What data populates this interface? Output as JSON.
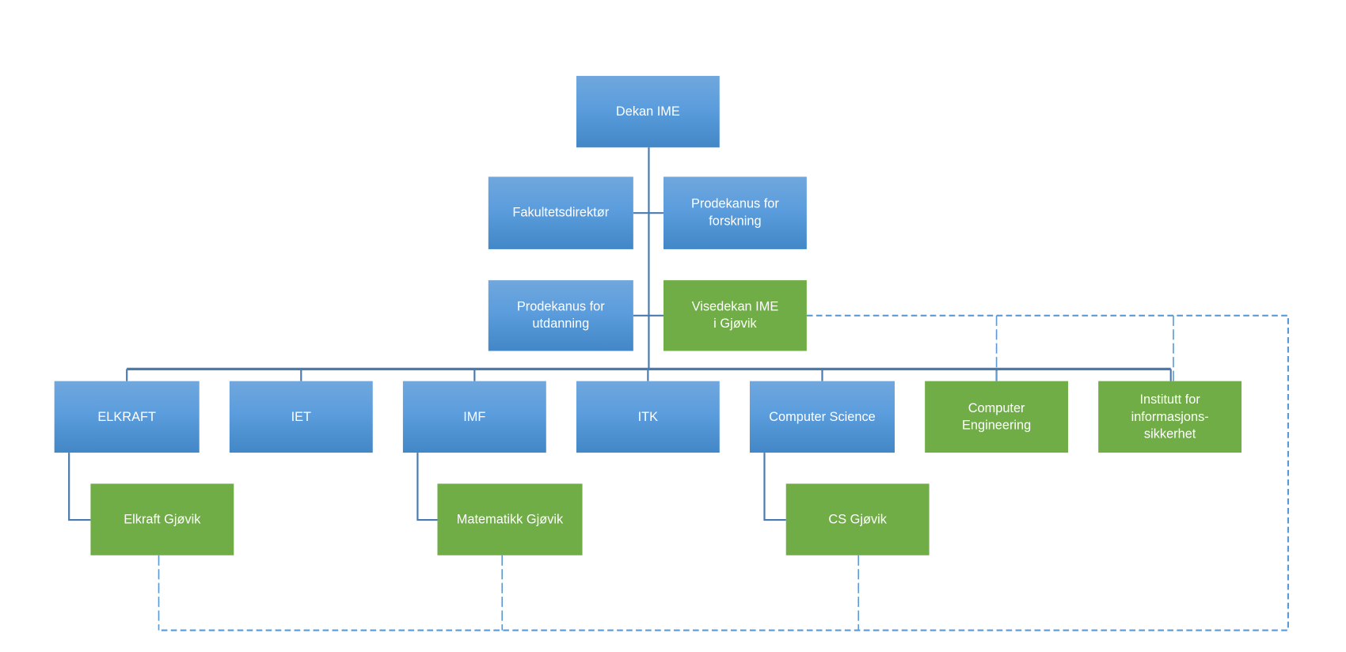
{
  "colors": {
    "blue": "#5b9bd5",
    "green": "#70ad47",
    "line": "#4a7ab0",
    "dashed": "#5b9bd5"
  },
  "top": {
    "dean": "Dekan IME"
  },
  "staff": {
    "faculty_director": "Fakultetsdirektør",
    "vice_dean_research": "Prodekanus for\nforskning",
    "vice_dean_education": "Prodekanus for\nutdanning",
    "deputy_dean_gjovik": "Visedekan IME\ni Gjøvik"
  },
  "departments": [
    {
      "label": "ELKRAFT",
      "color": "blue"
    },
    {
      "label": "IET",
      "color": "blue"
    },
    {
      "label": "IMF",
      "color": "blue"
    },
    {
      "label": "ITK",
      "color": "blue"
    },
    {
      "label": "Computer Science",
      "color": "blue"
    },
    {
      "label": "Computer\nEngineering",
      "color": "green"
    },
    {
      "label": "Institutt for\ninformasjons-\nsikkerhet",
      "color": "green"
    }
  ],
  "gjovik_units": [
    {
      "label": "Elkraft Gjøvik"
    },
    {
      "label": "Matematikk Gjøvik"
    },
    {
      "label": "CS Gjøvik"
    }
  ]
}
